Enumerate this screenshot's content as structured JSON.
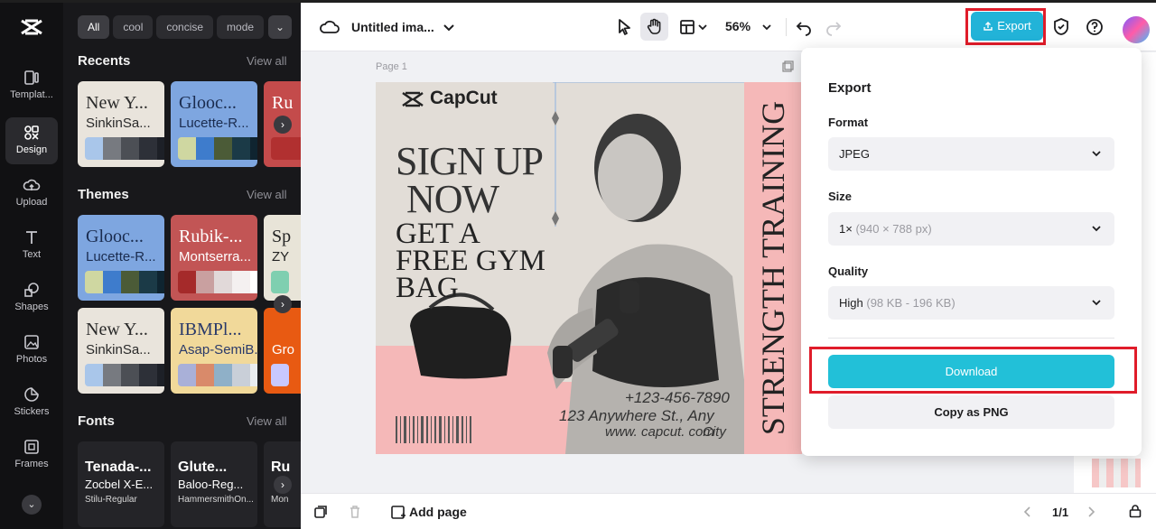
{
  "rail": {
    "items": [
      {
        "label": "Templat..."
      },
      {
        "label": "Design"
      },
      {
        "label": "Upload"
      },
      {
        "label": "Text"
      },
      {
        "label": "Shapes"
      },
      {
        "label": "Photos"
      },
      {
        "label": "Stickers"
      },
      {
        "label": "Frames"
      }
    ]
  },
  "panel": {
    "chips": [
      "All",
      "cool",
      "concise",
      "mode"
    ],
    "recents": {
      "title": "Recents",
      "view_all": "View all",
      "cards": [
        {
          "t1": "New Y...",
          "t2": "SinkinSa...",
          "bg": "#e9e4dc",
          "fg": "#2a2a2a",
          "swatches": [
            "#a9c6ea",
            "#777a80",
            "#4c4f55",
            "#2d3038",
            "#1d2027"
          ]
        },
        {
          "t1": "Glooc...",
          "t2": "Lucette-R...",
          "bg": "#7ea6e0",
          "fg": "#1a2c4f",
          "swatches": [
            "#cfd7a1",
            "#3e7ccc",
            "#4b5b37",
            "#1b3a47",
            "#0f2430"
          ]
        },
        {
          "t1": "Ru",
          "t2": "",
          "bg": "#c44b4b",
          "fg": "#fff",
          "swatches": [
            "#b13030",
            "#b13030"
          ]
        }
      ]
    },
    "themes": {
      "title": "Themes",
      "view_all": "View all",
      "cards": [
        {
          "t1": "Glooc...",
          "t2": "Lucette-R...",
          "bg": "#7ea6e0",
          "fg": "#1a2c4f",
          "swatches": [
            "#cfd7a1",
            "#3e7ccc",
            "#4b5b37",
            "#1b3a47",
            "#0f2430"
          ]
        },
        {
          "t1": "Rubik-...",
          "t2": "Montserra...",
          "bg": "#c25555",
          "fg": "#fff",
          "swatches": [
            "#a52a2a",
            "#c9a0a0",
            "#e1d9d9",
            "#f4f0f0",
            "#ffffff"
          ]
        },
        {
          "t1": "Sp",
          "t2": "ZY",
          "bg": "#e8e4d8",
          "fg": "#222",
          "swatches": [
            "#7fcfb0"
          ]
        },
        {
          "t1": "New Y...",
          "t2": "SinkinSa...",
          "bg": "#e9e4dc",
          "fg": "#2a2a2a",
          "swatches": [
            "#a9c6ea",
            "#777a80",
            "#4c4f55",
            "#2d3038",
            "#1d2027"
          ]
        },
        {
          "t1": "IBMPl...",
          "t2": "Asap-SemiB...",
          "bg": "#f1d99a",
          "fg": "#2a3a6a",
          "swatches": [
            "#a9b0d8",
            "#d98a6a",
            "#8fb0c8",
            "#c9cfd8",
            "#e8ecef"
          ]
        },
        {
          "t1": "",
          "t2": "Gro",
          "bg": "#e85a12",
          "fg": "#fff",
          "swatches": [
            "#c8c8ff"
          ]
        }
      ]
    },
    "fonts": {
      "title": "Fonts",
      "view_all": "View all",
      "cards": [
        {
          "f1": "Tenada-...",
          "f2": "Zocbel X-E...",
          "f3": "Stilu-Regular"
        },
        {
          "f1": "Glute...",
          "f2": "Baloo-Reg...",
          "f3": "HammersmithOn..."
        },
        {
          "f1": "Ru",
          "f2": "",
          "f3": "Mon"
        }
      ]
    }
  },
  "topbar": {
    "title": "Untitled ima...",
    "zoom": "56%",
    "export_label": "Export"
  },
  "canvas": {
    "page_label": "Page 1",
    "poster": {
      "brand": "CapCut",
      "headline1": "SIGN UP",
      "headline2": "NOW",
      "sub1": "GET A",
      "sub2": "FREE GYM",
      "sub3": "BAG",
      "side_text": "STRENGTH TRAINING",
      "phone": "+123-456-7890",
      "address": "123 Anywhere St., Any",
      "website": "www. capcut. com",
      "city": "City"
    }
  },
  "bottombar": {
    "add_page": "Add page",
    "pager": "1/1"
  },
  "export_popup": {
    "title": "Export",
    "format_label": "Format",
    "format_value": "JPEG",
    "size_label": "Size",
    "size_value": "1×",
    "size_detail": "(940 × 788 px)",
    "quality_label": "Quality",
    "quality_value": "High",
    "quality_detail": "(98 KB - 196 KB)",
    "download_label": "Download",
    "copy_label": "Copy as PNG"
  }
}
